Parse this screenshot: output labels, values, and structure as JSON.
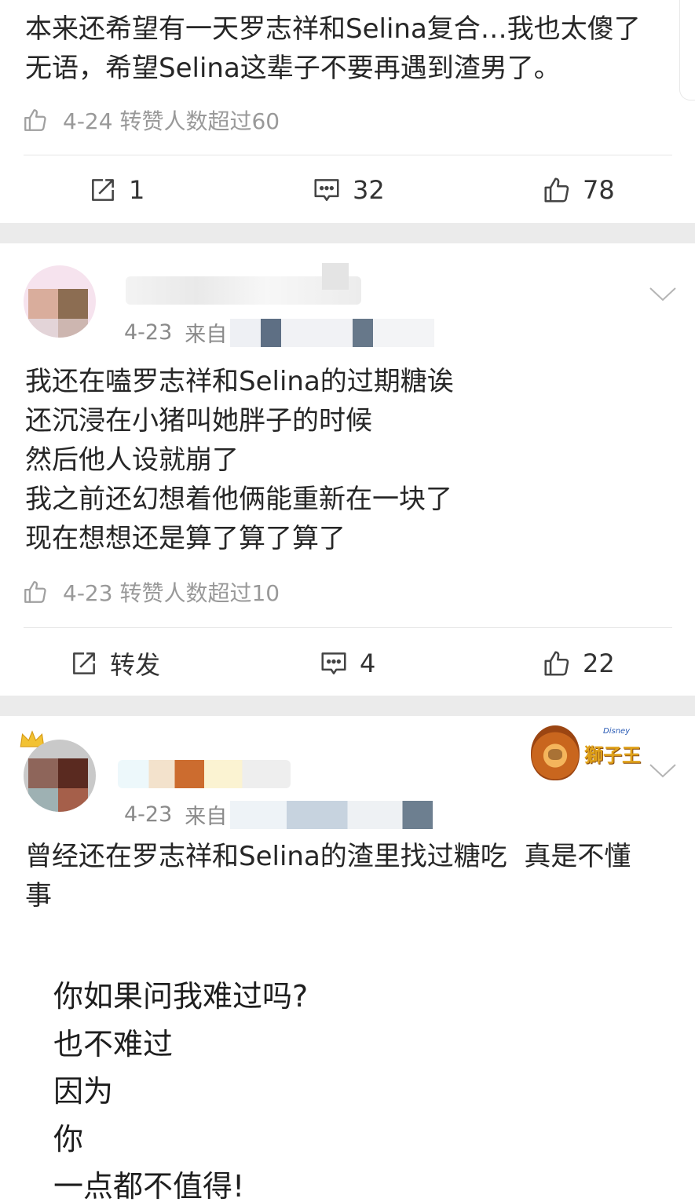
{
  "post1": {
    "text": "本来还希望有一天罗志祥和Selina复合…我也太傻了\n无语，希望Selina这辈子不要再遇到渣男了。",
    "meta": "4-24 转赞人数超过60",
    "actions": {
      "repost": "1",
      "comment": "32",
      "like": "78"
    }
  },
  "post2": {
    "time": "4-23",
    "source_prefix": "来自",
    "text": "我还在嗑罗志祥和Selina的过期糖诶\n还沉浸在小猪叫她胖子的时候\n然后他人设就崩了\n我之前还幻想着他俩能重新在一块了\n现在想想还是算了算了算了",
    "meta": "4-23 转赞人数超过10",
    "actions": {
      "repost": "转发",
      "comment": "4",
      "like": "22"
    }
  },
  "post3": {
    "time": "4-23",
    "source_prefix": "来自",
    "badge": {
      "text": "獅子王",
      "brand": "Disney"
    },
    "text": "曾经还在罗志祥和Selina的渣里找过糖吃  真是不懂\n事",
    "poem": "你如果问我难过吗?\n也不难过\n因为\n你\n一点都不值得!"
  },
  "colors": {
    "meta": "#999999",
    "separator": "#ebebeb",
    "badge": "#e0a21a"
  }
}
